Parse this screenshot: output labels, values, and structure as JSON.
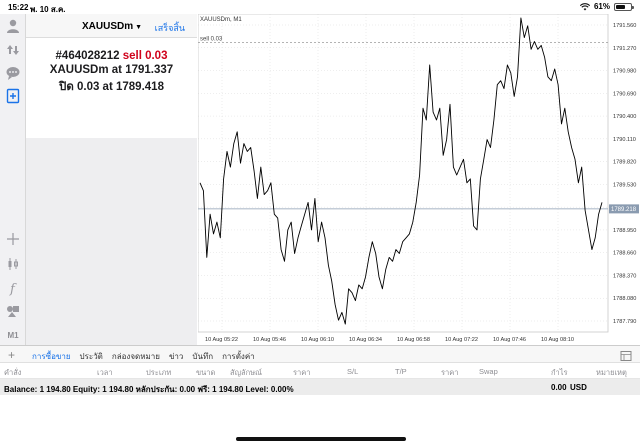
{
  "status": {
    "time": "15:22",
    "date": "พ. 10 ส.ค.",
    "battery": "61%",
    "battery_level": 0.61
  },
  "order_panel": {
    "symbol": "XAUUSDm",
    "done_label": "เสร็จสิ้น",
    "ticket": "#464028212",
    "action": "sell 0.03",
    "entry_text": "XAUUSDm at",
    "entry_price": "1791.337",
    "close_text": "ปิด 0.03 at",
    "close_price": "1789.418"
  },
  "toolbar": {
    "icons": [
      "account-icon",
      "trade-icon",
      "chat-icon",
      "new-order-icon",
      "crosshair-icon",
      "candles-icon",
      "indicator-f-icon",
      "objects-icon"
    ],
    "timeframe": "M1"
  },
  "chart": {
    "symbol_label": "XAUUSDm, M1",
    "order_line_label": "sell 0.03",
    "current_price_label": "1789.218",
    "colors": {
      "line": "#000000",
      "grid": "#dcdcdc",
      "current": "#8a9bb0",
      "order": "#9a9a9a"
    }
  },
  "chart_data": {
    "type": "line",
    "ylim": [
      1787.65,
      1791.7
    ],
    "y_ticks": [
      "1791.560",
      "1791.270",
      "1790.980",
      "1790.690",
      "1790.400",
      "1790.110",
      "1789.820",
      "1789.530",
      "1789.240",
      "1788.950",
      "1788.660",
      "1788.370",
      "1788.080",
      "1787.790"
    ],
    "y_tick_values": [
      1791.56,
      1791.27,
      1790.98,
      1790.69,
      1790.4,
      1790.11,
      1789.82,
      1789.53,
      1789.24,
      1788.95,
      1788.66,
      1788.37,
      1788.08,
      1787.79
    ],
    "x_ticks": [
      "10 Aug 05:22",
      "10 Aug 05:46",
      "10 Aug 06:10",
      "10 Aug 06:34",
      "10 Aug 06:58",
      "10 Aug 07:22",
      "10 Aug 07:46",
      "10 Aug 08:10"
    ],
    "order_level": 1791.337,
    "current_level": 1789.218,
    "series": [
      {
        "values": [
          1789.55,
          1789.45,
          1788.6,
          1789.15,
          1788.9,
          1789.05,
          1788.85,
          1789.6,
          1789.95,
          1789.75,
          1790.05,
          1790.2,
          1789.8,
          1790.05,
          1789.95,
          1790.0,
          1789.7,
          1789.35,
          1789.75,
          1789.4,
          1789.45,
          1789.55,
          1789.15,
          1789.1,
          1788.7,
          1788.55,
          1788.95,
          1789.05,
          1788.65,
          1788.85,
          1789.0,
          1789.15,
          1789.3,
          1788.95,
          1789.35,
          1788.8,
          1789.05,
          1788.85,
          1788.5,
          1788.3,
          1788.0,
          1787.8,
          1787.9,
          1787.75,
          1788.2,
          1788.15,
          1788.05,
          1788.25,
          1788.2,
          1788.35,
          1788.6,
          1788.8,
          1788.65,
          1788.35,
          1788.2,
          1788.45,
          1788.6,
          1788.55,
          1788.7,
          1788.65,
          1788.8,
          1788.85,
          1788.9,
          1789.05,
          1789.3,
          1789.65,
          1790.5,
          1790.35,
          1791.05,
          1790.45,
          1790.35,
          1790.5,
          1789.9,
          1790.1,
          1790.55,
          1789.75,
          1789.65,
          1789.75,
          1789.85,
          1789.55,
          1789.6,
          1789.0,
          1788.95,
          1789.6,
          1789.85,
          1790.1,
          1790.0,
          1790.35,
          1790.8,
          1790.85,
          1790.75,
          1791.05,
          1790.95,
          1790.65,
          1790.9,
          1791.65,
          1791.4,
          1791.55,
          1791.25,
          1791.35,
          1791.25,
          1791.3,
          1791.15,
          1790.9,
          1790.85,
          1791.0,
          1790.8,
          1790.3,
          1790.5,
          1790.2,
          1790.0,
          1789.85,
          1789.55,
          1789.75,
          1789.2,
          1788.95,
          1788.7,
          1788.85,
          1789.15,
          1789.3
        ]
      }
    ]
  },
  "bottom_tabs": {
    "items": [
      "การซื้อขาย",
      "ประวัติ",
      "กล่องจดหมาย",
      "ข่าว",
      "บันทึก",
      "การตั้งค่า"
    ],
    "active_index": 0
  },
  "columns": [
    "คำสั่ง",
    "เวลา",
    "ประเภท",
    "ขนาด",
    "สัญลักษณ์",
    "ราคา",
    "S/L",
    "T/P",
    "ราคา",
    "Swap",
    "กำไร",
    "หมายเหตุ"
  ],
  "account": {
    "summary": "Balance: 1 194.80 Equity: 1 194.80 หลักประกัน: 0.00 ฟรี: 1 194.80 Level: 0.00%",
    "profit": "0.00",
    "currency": "USD"
  }
}
